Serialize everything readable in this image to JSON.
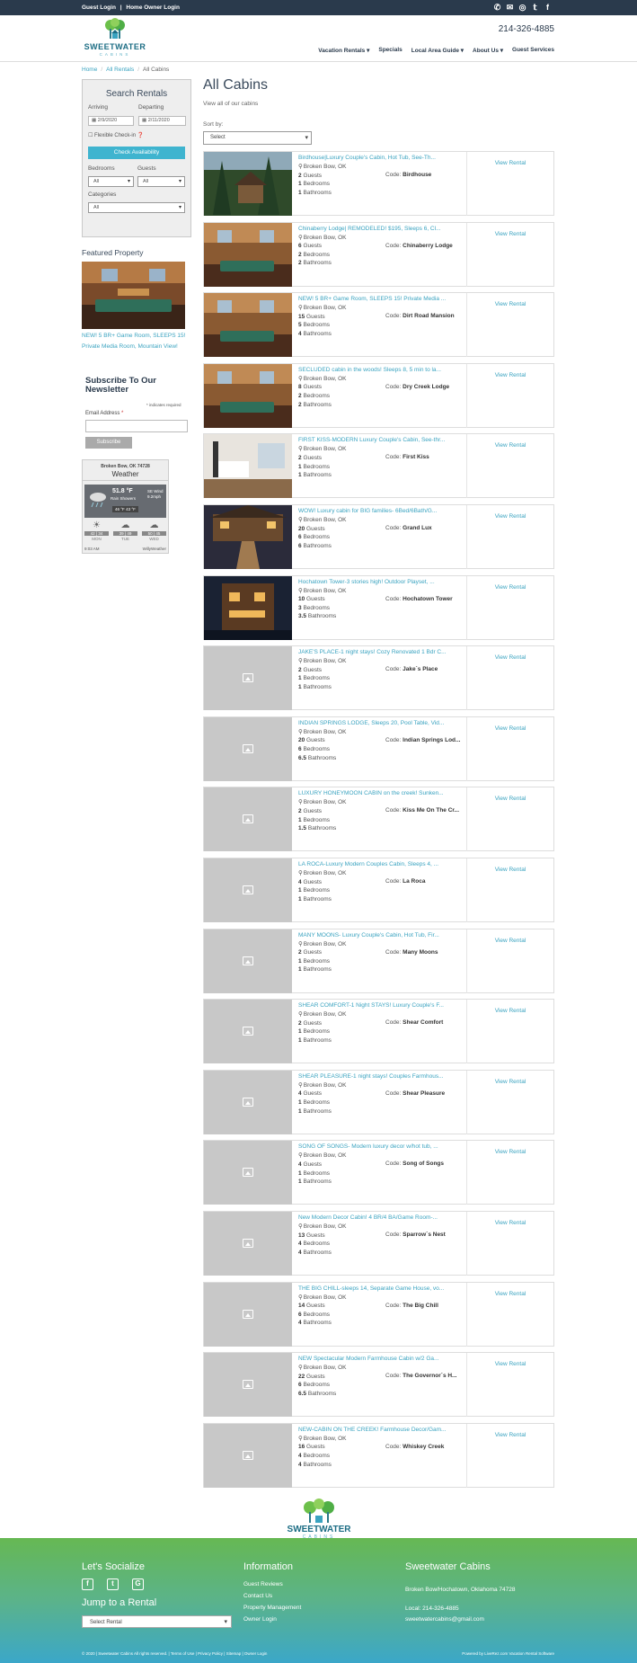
{
  "topbar": {
    "guest_login": "Guest Login",
    "separator": "|",
    "owner_login": "Home Owner Login",
    "icons": [
      "phone-icon",
      "email-icon",
      "instagram-icon",
      "twitter-icon",
      "facebook-icon"
    ]
  },
  "brand": {
    "name": "SWEETWATER",
    "sub": "CABINS",
    "phone": "214-326-4885",
    "colors": {
      "dark": "#2a3a4c",
      "accent": "#3aa3c0",
      "button": "#3fb4cf",
      "logo": "#1c6d84"
    }
  },
  "nav": [
    "Vacation Rentals ▾",
    "Specials",
    "Local Area Guide ▾",
    "About Us ▾",
    "Guest Services"
  ],
  "breadcrumb": {
    "home": "Home",
    "all_rentals": "All Rentals",
    "current": "All Cabins"
  },
  "search": {
    "title": "Search Rentals",
    "arriving_label": "Arriving",
    "departing_label": "Departing",
    "arriving": "2/9/2020",
    "departing": "2/11/2020",
    "flexible": "Flexible Check-in",
    "check": "Check Availability",
    "bedrooms_label": "Bedrooms",
    "guests_label": "Guests",
    "bedrooms": "All",
    "guests": "All",
    "categories_label": "Categories",
    "categories": "All"
  },
  "featured": {
    "heading": "Featured Property",
    "caption": "NEW! 5 BR+ Game Room, SLEEPS 15! Private Media Room, Mountain View!"
  },
  "newsletter": {
    "heading": "Subscribe To Our Newsletter",
    "required": "* indicates required",
    "email_label": "Email Address",
    "asterisk": "*",
    "subscribe": "Subscribe"
  },
  "weather": {
    "location": "Broken Bow, OK 74728",
    "title": "Weather",
    "temp": "51.8 °F",
    "condition": "Rain Showers",
    "wind_dir": "SE Wind",
    "wind_speed": "9.2mph",
    "hi": "46 °F",
    "lo": "43 °F",
    "days": [
      {
        "name": "MON",
        "hi": "42",
        "lo": "34"
      },
      {
        "name": "TUE",
        "hi": "39",
        "lo": "49"
      },
      {
        "name": "WED",
        "hi": "50",
        "lo": "45"
      }
    ],
    "time": "9:03 AM",
    "credit": "WillyWeather"
  },
  "main": {
    "title": "All Cabins",
    "subtitle": "View all of our cabins",
    "sort_label": "Sort by:",
    "sort_value": "Select"
  },
  "listing_labels": {
    "location": "Broken Bow, OK",
    "guests": "Guests",
    "bedrooms": "Bedrooms",
    "bathrooms": "Bathrooms",
    "code": "Code:",
    "view": "View Rental"
  },
  "listings": [
    {
      "title": "Birdhouse|Luxury Couple's Cabin, Hot Tub, See-Th...",
      "guests": "2",
      "bedrooms": "1",
      "bathrooms": "1",
      "code": "Birdhouse",
      "photo": "forest"
    },
    {
      "title": "Chinaberry Lodge| REMODELED! $195, Sleeps 6, Cl...",
      "guests": "6",
      "bedrooms": "2",
      "bathrooms": "2",
      "code": "Chinaberry Lodge",
      "photo": "wood"
    },
    {
      "title": "NEW! 5 BR+ Game Room, SLEEPS 15! Private Media ...",
      "guests": "15",
      "bedrooms": "5",
      "bathrooms": "4",
      "code": "Dirt Road Mansion",
      "photo": "wood"
    },
    {
      "title": "SECLUDED cabin in the woods! Sleeps 8, 5 min to la...",
      "guests": "8",
      "bedrooms": "2",
      "bathrooms": "2",
      "code": "Dry Creek Lodge",
      "photo": "wood"
    },
    {
      "title": "FIRST KISS-MODERN Luxury Couple's Cabin, See-thr...",
      "guests": "2",
      "bedrooms": "1",
      "bathrooms": "1",
      "code": "First Kiss",
      "photo": "white"
    },
    {
      "title": "WOW! Luxury cabin for BIG families- 6Bed/6Bath/G...",
      "guests": "20",
      "bedrooms": "6",
      "bathrooms": "6",
      "code": "Grand Lux",
      "photo": "stairs"
    },
    {
      "title": "Hochatown Tower-3 stories high! Outdoor Playset, ...",
      "guests": "10",
      "bedrooms": "3",
      "bathrooms": "3.5",
      "code": "Hochatown Tower",
      "photo": "night"
    },
    {
      "title": "JAKE'S PLACE-1 night stays! Cozy Renovated 1 Bdr C...",
      "guests": "2",
      "bedrooms": "1",
      "bathrooms": "1",
      "code": "Jake`s Place",
      "photo": "none"
    },
    {
      "title": "INDIAN SPRINGS LODGE, Sleeps 20, Pool Table, Vid...",
      "guests": "20",
      "bedrooms": "6",
      "bathrooms": "6.5",
      "code": "Indian Springs Lod...",
      "photo": "none"
    },
    {
      "title": "LUXURY HONEYMOON CABIN on the creek! Sunken...",
      "guests": "2",
      "bedrooms": "1",
      "bathrooms": "1.5",
      "code": "Kiss Me On The Cr...",
      "photo": "none"
    },
    {
      "title": "LA ROCA-Luxury Modern Couples Cabin, Sleeps 4, ...",
      "guests": "4",
      "bedrooms": "1",
      "bathrooms": "1",
      "code": "La Roca",
      "photo": "none"
    },
    {
      "title": "MANY MOONS- Luxury Couple's Cabin, Hot Tub, Fir...",
      "guests": "2",
      "bedrooms": "1",
      "bathrooms": "1",
      "code": "Many Moons",
      "photo": "none"
    },
    {
      "title": "SHEAR COMFORT-1 Night STAYS! Luxury Couple's F...",
      "guests": "2",
      "bedrooms": "1",
      "bathrooms": "1",
      "code": "Shear Comfort",
      "photo": "none"
    },
    {
      "title": "SHEAR PLEASURE-1 night stays! Couples Farmhous...",
      "guests": "4",
      "bedrooms": "1",
      "bathrooms": "1",
      "code": "Shear Pleasure",
      "photo": "none"
    },
    {
      "title": "SONG OF SONGS- Modern luxury decor w/hot tub, ...",
      "guests": "4",
      "bedrooms": "1",
      "bathrooms": "1",
      "code": "Song of Songs",
      "photo": "none"
    },
    {
      "title": "New Modern Decor Cabin! 4 BR/4 BA/Game Room-...",
      "guests": "13",
      "bedrooms": "4",
      "bathrooms": "4",
      "code": "Sparrow`s Nest",
      "photo": "none"
    },
    {
      "title": "THE BIG CHILL-sleeps 14, Separate Game House, vo...",
      "guests": "14",
      "bedrooms": "6",
      "bathrooms": "4",
      "code": "The Big Chill",
      "photo": "none"
    },
    {
      "title": "NEW Spectacular Modern Farmhouse Cabin w/2 Ga...",
      "guests": "22",
      "bedrooms": "6",
      "bathrooms": "6.5",
      "code": "The Governor`s H...",
      "photo": "none"
    },
    {
      "title": "NEW-CABIN ON THE CREEK! Farmhouse Decor/Gam...",
      "guests": "16",
      "bedrooms": "4",
      "bathrooms": "4",
      "code": "Whiskey Creek",
      "photo": "none"
    }
  ],
  "footer": {
    "social_heading": "Let's Socialize",
    "social_icons": [
      "facebook-icon",
      "twitter-icon",
      "google-plus-icon"
    ],
    "jump_heading": "Jump to a Rental",
    "jump_select": "Select Rental",
    "info_heading": "Information",
    "info_links": [
      "Guest Reviews",
      "Contact Us",
      "Property Management",
      "Owner Login"
    ],
    "company_heading": "Sweetwater Cabins",
    "address": "Broken Bow/Hochatown, Oklahoma 74728",
    "local": "Local: 214-326-4885",
    "email": "sweetwatercabins@gmail.com",
    "copyright": "© 2020 | Sweetwater Cabins All rights reserved. | Terms of Use | Privacy Policy | Sitemap | Owner Login",
    "powered": "Powered by LiveRez.com Vacation Rental Software"
  }
}
